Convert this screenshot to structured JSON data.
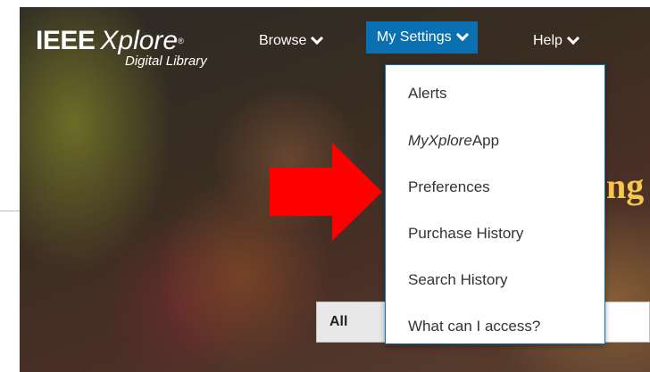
{
  "logo": {
    "ieee": "IEEE",
    "xplore": "Xplore",
    "reg": "®",
    "sub": "Digital Library"
  },
  "nav": {
    "browse": "Browse",
    "my_settings": "My Settings",
    "help": "Help"
  },
  "menu": {
    "items": [
      {
        "label": "Alerts"
      },
      {
        "label_italic": "MyXplore",
        "label": "App"
      },
      {
        "label": "Preferences"
      },
      {
        "label": "Purchase History"
      },
      {
        "label": "Search History"
      },
      {
        "label": "What can I access?"
      }
    ]
  },
  "headline_partial": "ng",
  "search": {
    "scope": "All"
  },
  "colors": {
    "nav_active": "#0b70b2",
    "arrow": "#ff0000",
    "headline": "#f6c74a"
  },
  "icons": {
    "nav_dropdown": "chevron-down-icon",
    "annotation": "red-arrow-icon"
  }
}
